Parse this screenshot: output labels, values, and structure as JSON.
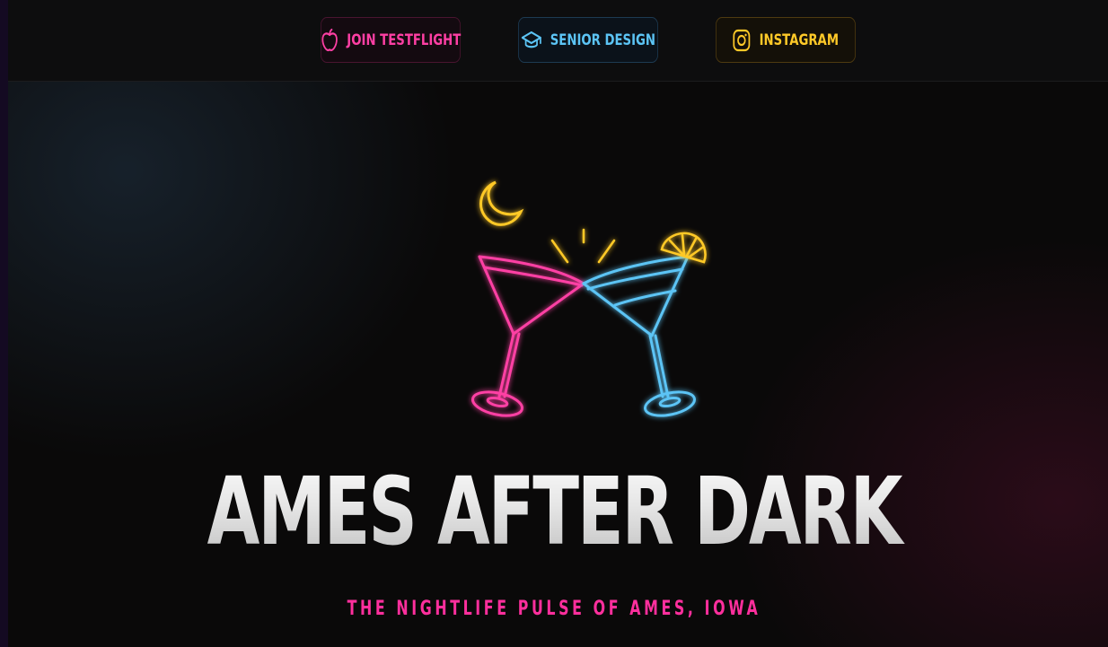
{
  "nav": {
    "buttons": [
      {
        "label": "JOIN TESTFLIGHT",
        "icon": "apple-icon",
        "color": "#ff3fa4"
      },
      {
        "label": "SENIOR DESIGN",
        "icon": "graduation-cap-icon",
        "color": "#5cc4f5"
      },
      {
        "label": "INSTAGRAM",
        "icon": "instagram-icon",
        "color": "#ffc928"
      }
    ]
  },
  "hero": {
    "title": "AMES AFTER DARK",
    "tagline": "THE NIGHTLIFE PULSE OF AMES, IOWA",
    "art": {
      "icons": [
        "moon-icon",
        "cocktail-glass-icon",
        "cocktail-glass-icon",
        "lemon-slice-icon",
        "sparkle-icon"
      ],
      "colors": {
        "pink": "#ff3fa4",
        "blue": "#5cc4f5",
        "gold": "#ffc928"
      }
    }
  }
}
